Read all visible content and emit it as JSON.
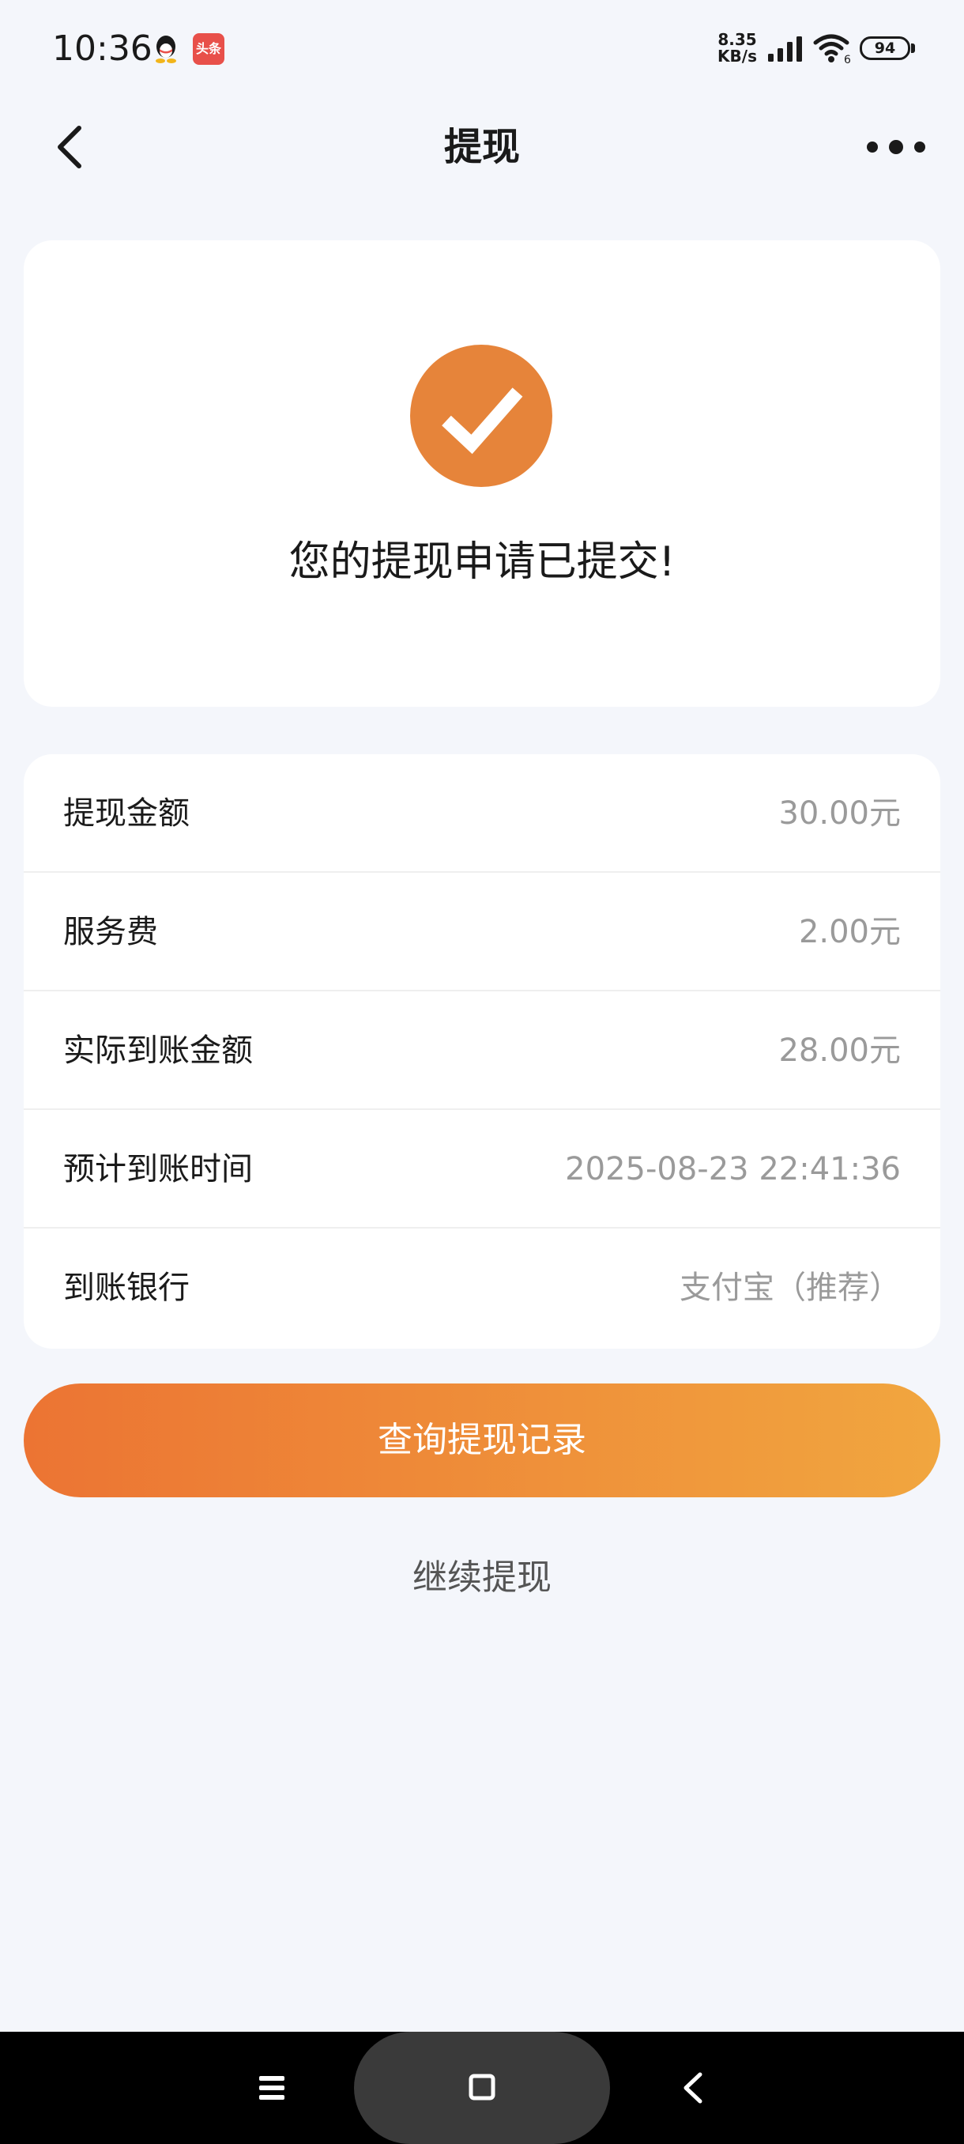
{
  "status_bar": {
    "time": "10:36",
    "net_speed_value": "8.35",
    "net_speed_unit": "KB/s",
    "battery": "94",
    "app_icons": [
      "qq-icon",
      "toutiao-icon"
    ],
    "toutiao_label": "头条"
  },
  "nav": {
    "title": "提现",
    "back_icon": "chevron-left-icon",
    "more_icon": "more-dots-icon"
  },
  "success": {
    "icon": "check-circle-icon",
    "message": "您的提现申请已提交!"
  },
  "details": {
    "rows": [
      {
        "label": "提现金额",
        "value": "30.00元"
      },
      {
        "label": "服务费",
        "value": "2.00元"
      },
      {
        "label": "实际到账金额",
        "value": "28.00元"
      },
      {
        "label": "预计到账时间",
        "value": "2025-08-23 22:41:36"
      },
      {
        "label": "到账银行",
        "value": "支付宝（推荐）"
      }
    ]
  },
  "actions": {
    "query_button": "查询提现记录",
    "continue_link": "继续提现"
  },
  "colors": {
    "accent": "#e6843a",
    "gradient_start": "#ec7433",
    "gradient_end": "#f1a63f",
    "background": "#f4f6fb"
  }
}
